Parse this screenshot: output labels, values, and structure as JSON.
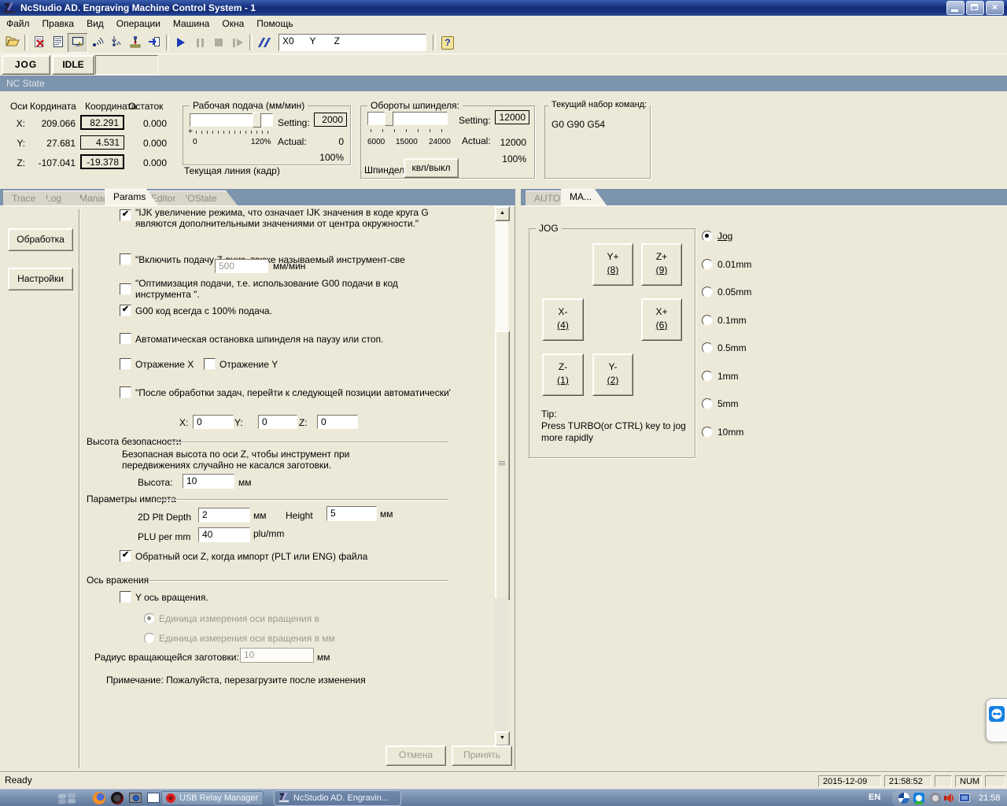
{
  "icons": {
    "check": "✔",
    "question": "?",
    "up_arrow": "▲",
    "down_arrow": "▼",
    "close": "×"
  },
  "window": {
    "title": "NcStudio AD. Engraving Machine Control System  - 1"
  },
  "menu": {
    "items": [
      "Файл",
      "Правка",
      "Вид",
      "Операции",
      "Машина",
      "Окна",
      "Помощь"
    ]
  },
  "toolbar": {
    "coords_field": "X0      Y       Z"
  },
  "mode": {
    "jog": "JOG",
    "idle": "IDLE"
  },
  "nc_state": {
    "title": "NC State"
  },
  "coords": {
    "headers": [
      "Оси",
      "Кордината",
      "Координата",
      "Остаток"
    ],
    "rows": [
      {
        "axis": "X:",
        "machine": "209.066",
        "work": "82.291",
        "rest": "0.000"
      },
      {
        "axis": "Y:",
        "machine": "27.681",
        "work": "4.531",
        "rest": "0.000"
      },
      {
        "axis": "Z:",
        "machine": "-107.041",
        "work": "-19.378",
        "rest": "0.000"
      }
    ]
  },
  "feed": {
    "title": "Рабочая подача (мм/мин)",
    "min": "0",
    "max": "120%",
    "setting_label": "Setting:",
    "setting": "2000",
    "actual_label": "Actual:",
    "actual": "0",
    "percent": "100%",
    "current_line": "Текущая линия (кадр)"
  },
  "spindle": {
    "title": "Обороты шпинделя:",
    "ticks": [
      "6000",
      "15000",
      "24000"
    ],
    "setting_label": "Setting:",
    "setting": "12000",
    "actual_label": "Actual:",
    "actual": "12000",
    "percent": "100%",
    "label": "Шпиндель",
    "toggle": "квл/выкл"
  },
  "commands": {
    "title": "Текущий набор команд:",
    "value": "G0 G90 G54"
  },
  "left_tabs": [
    "Trace",
    "Log",
    "Manager",
    "Params",
    "Editor",
    "IOState"
  ],
  "right_tabs": [
    "AUTO",
    "MA..."
  ],
  "sidebar": {
    "processing": "Обработка",
    "settings": "Настройки"
  },
  "params": {
    "ijk_line1": "\"IJK увеличение режима, что означает IJK значения в коде круга G",
    "ijk_line2": "являются дополнительными значениями от центра окружности.\"",
    "zdown": "\"Включить подачу Z-вниз, также называемый инструмент-све",
    "zdown_value": "500",
    "zdown_unit": "мм/мин",
    "opt_line1": "\"Оптимизация подачи, т.е. использование G00 подачи в код",
    "opt_line2": "инструмента \".",
    "g00": "G00 код всегда с 100% подача.",
    "autostop": "Автоматическая остановка шпинделя на паузу или стоп.",
    "mirror_x": "Отражение  X",
    "mirror_y": "Отражение Y",
    "next_pos": "\"После обработки задач, перейти к следующей позиции автоматически'",
    "x_label": "X:",
    "y_label": "Y:",
    "z_label": "Z:",
    "x_value": "0",
    "y_value": "0",
    "z_value": "0",
    "safe": {
      "title": "Высота безопасности",
      "desc1": "Безопасная высота по оси Z, чтобы инструмент при",
      "desc2": "передвижениях случайно не касался заготовки.",
      "label": "Высота:",
      "value": "10",
      "unit": "мм"
    },
    "import": {
      "title": "Параметры импорта",
      "plt_label": "2D Plt Depth",
      "plt_value": "2",
      "plt_unit": "мм",
      "height_label": "Height",
      "height_value": "5",
      "height_unit": "мм",
      "plu_label": "PLU per mm",
      "plu_value": "40",
      "plu_unit": "plu/mm"
    },
    "reverse_z": "Обратный оси Z, когда импорт (PLT или ENG) файла",
    "rotation": {
      "title": "Ось вражения",
      "cb": "Y ось вращения.",
      "unit_deg": "Единица измерения оси вращения в",
      "unit_mm": "Единица измерения оси вращения в мм",
      "radius_label": "Радиус вращающейся заготовки:",
      "radius_value": "10",
      "radius_unit": "мм"
    },
    "note": "Примечание: Пожалуйста, перезагрузите после изменения",
    "cancel": "Отмена",
    "apply": "Принять"
  },
  "jog": {
    "title": "JOG",
    "buttons": [
      {
        "l": "Y+",
        "k": "(8)"
      },
      {
        "l": "Z+",
        "k": "(9)"
      },
      {
        "l": "X-",
        "k": "(4)"
      },
      {
        "l": "X+",
        "k": "(6)"
      },
      {
        "l": "Z-",
        "k": "(1)"
      },
      {
        "l": "Y-",
        "k": "(2)"
      }
    ],
    "tip1": "Tip:",
    "tip2": "Press TURBO(or CTRL) key to jog",
    "tip3": "more rapidly"
  },
  "steps": [
    "Jog",
    "0.01mm",
    "0.05mm",
    "0.1mm",
    "0.5mm",
    "1mm",
    "5mm",
    "10mm"
  ],
  "statusbar": {
    "ready": "Ready",
    "date": "2015-12-09",
    "time": "21:58:52",
    "num": "NUM"
  },
  "taskbar": {
    "usb": "USB Relay Manager",
    "ncstudio": "NcStudio AD. Engravin...",
    "lang": "EN",
    "clock": "21:58"
  }
}
